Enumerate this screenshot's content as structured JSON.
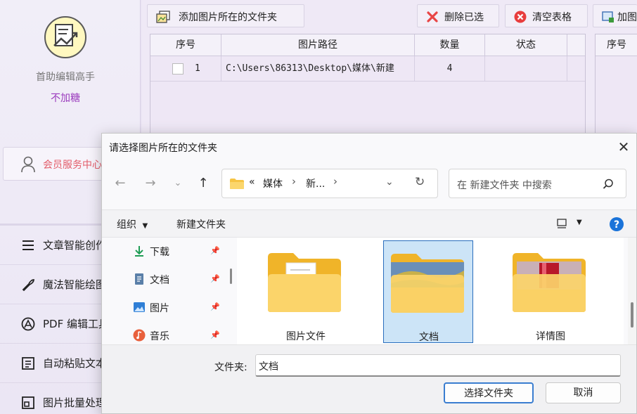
{
  "sidebar": {
    "app_name": "首助编辑高手",
    "app_subtitle": "不加糖",
    "member_label": "会员服务中心",
    "items": [
      {
        "label": "文章智能创作",
        "icon": "menu-lines-icon"
      },
      {
        "label": "魔法智能绘图",
        "icon": "magic-wand-icon"
      },
      {
        "label": "PDF 编辑工具",
        "icon": "pdf-circle-icon"
      },
      {
        "label": "自动粘贴文本",
        "icon": "text-box-icon"
      },
      {
        "label": "图片批量处理",
        "icon": "image-frame-icon"
      }
    ]
  },
  "toolbar": {
    "add_folder": "添加图片所在的文件夹",
    "delete_selected": "删除已选",
    "clear_table": "清空表格",
    "add_more": "加图"
  },
  "table": {
    "headers": [
      "序号",
      "图片路径",
      "数量",
      "状态"
    ],
    "rows": [
      {
        "index": "1",
        "path": "C:\\Users\\86313\\Desktop\\媒体\\新建",
        "count": "4",
        "status": ""
      }
    ],
    "second_header": "序号"
  },
  "dialog": {
    "title": "请选择图片所在的文件夹",
    "breadcrumb": [
      "«",
      "媒体",
      "新..."
    ],
    "search_placeholder": "在 新建文件夹 中搜索",
    "organize": "组织",
    "new_folder": "新建文件夹",
    "nav_items": [
      {
        "label": "下载",
        "icon": "download-icon"
      },
      {
        "label": "文档",
        "icon": "document-icon"
      },
      {
        "label": "图片",
        "icon": "picture-icon"
      },
      {
        "label": "音乐",
        "icon": "music-icon"
      }
    ],
    "folders": [
      {
        "name": "图片文件",
        "selected": false
      },
      {
        "name": "文档",
        "selected": true
      },
      {
        "name": "详情图",
        "selected": false
      }
    ],
    "folder_label": "文件夹:",
    "folder_value": "文档",
    "select_button": "选择文件夹",
    "cancel_button": "取消"
  },
  "colors": {
    "accent_purple": "#9b3bbd",
    "member_red": "#e35d6a",
    "selection_blue": "#cce4f7",
    "folder_yellow": "#f6c443"
  }
}
